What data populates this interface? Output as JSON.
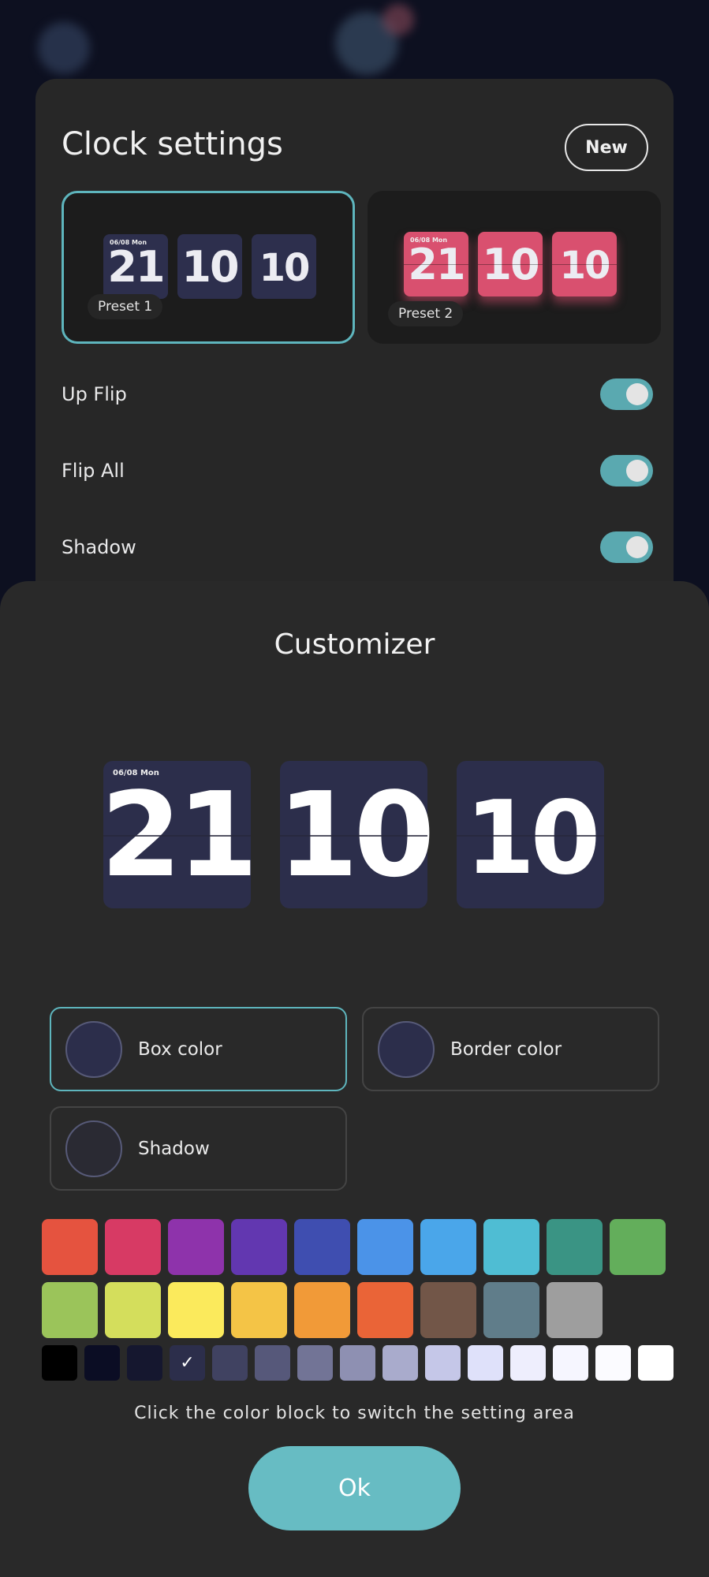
{
  "settings": {
    "title": "Clock settings",
    "new_label": "New",
    "presets": [
      {
        "label": "Preset 1",
        "digits": [
          "21",
          "10",
          "10"
        ],
        "date": "06/08 Mon",
        "box_color": "#2d2f4d",
        "selected": true
      },
      {
        "label": "Preset 2",
        "digits": [
          "21",
          "10",
          "10"
        ],
        "date": "06/08 Mon",
        "box_color": "#d9506f",
        "selected": false
      }
    ],
    "toggles": [
      {
        "label": "Up Flip",
        "on": true
      },
      {
        "label": "Flip All",
        "on": true
      },
      {
        "label": "Shadow",
        "on": true
      }
    ]
  },
  "customizer": {
    "title": "Customizer",
    "preview": {
      "date": "06/08 Mon",
      "digits": [
        "21",
        "10",
        "10"
      ]
    },
    "options": [
      {
        "label": "Box color",
        "color": "#2c2e4b",
        "selected": true
      },
      {
        "label": "Border color",
        "color": "#2c2e4b",
        "selected": false
      },
      {
        "label": "Shadow",
        "color": "#2a2a33",
        "selected": false
      }
    ],
    "palette_row1": [
      "#e5533f",
      "#d73a64",
      "#8e33ab",
      "#6237b0",
      "#3f4eb0",
      "#4b93e8",
      "#4aa6ea",
      "#4fbdd3",
      "#3a9484",
      "#63ae5b"
    ],
    "palette_row2": [
      "#9bc45a",
      "#d4de5c",
      "#fbea5c",
      "#f4c446",
      "#f19a38",
      "#ea6437",
      "#725648",
      "#607d8a",
      "#9e9e9e"
    ],
    "palette_row3": [
      "#000000",
      "#0b0d24",
      "#15172f",
      "#2c2e4b",
      "#404261",
      "#56587a",
      "#727496",
      "#8e90b2",
      "#a9abcc",
      "#c5c7e8",
      "#dfe1fa",
      "#eeeefd",
      "#f6f6ff",
      "#fbfbff",
      "#ffffff"
    ],
    "selected_index_row3": 3,
    "check_mark": "✓",
    "hint": "Click the color block to switch the setting area",
    "ok_label": "Ok"
  }
}
